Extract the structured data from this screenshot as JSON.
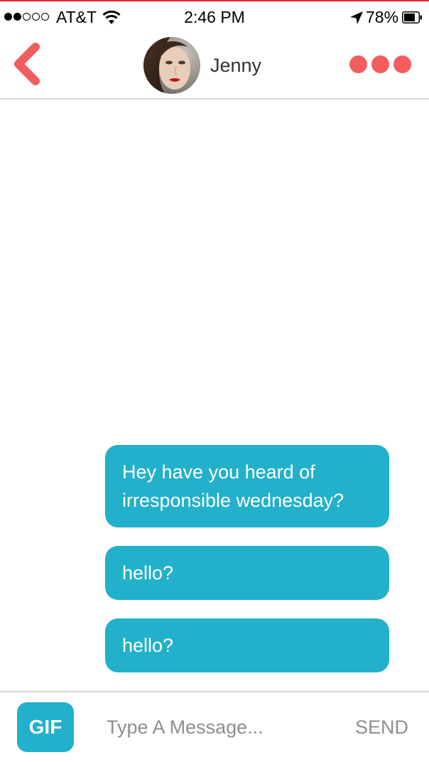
{
  "status_bar": {
    "signal_strength": "2 of 5",
    "carrier": "AT&T",
    "time": "2:46 PM",
    "battery": "78%",
    "icons": [
      "wifi-icon",
      "location-arrow-icon",
      "battery-icon"
    ]
  },
  "header": {
    "back_icon": "chevron-left-icon",
    "contact_name": "Jenny",
    "avatar": "contact-avatar-photo",
    "more_icon": "more-dots-icon"
  },
  "messages": [
    {
      "text": "Hey have you heard of irresponsible wednesday?"
    },
    {
      "text": "hello?"
    },
    {
      "text": "hello?"
    }
  ],
  "composer": {
    "gif_label": "GIF",
    "placeholder": "Type A Message...",
    "value": "",
    "send_label": "SEND"
  },
  "colors": {
    "accent_red": "#f35d5f",
    "bubble_blue": "#22b0cb",
    "frame_red": "#e5202b"
  }
}
